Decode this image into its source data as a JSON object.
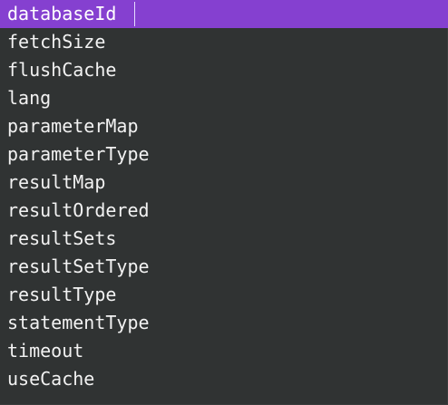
{
  "autocomplete": {
    "selected_index": 0,
    "items": [
      "databaseId",
      "fetchSize",
      "flushCache",
      "lang",
      "parameterMap",
      "parameterType",
      "resultMap",
      "resultOrdered",
      "resultSets",
      "resultSetType",
      "resultType",
      "statementType",
      "timeout",
      "useCache"
    ]
  }
}
